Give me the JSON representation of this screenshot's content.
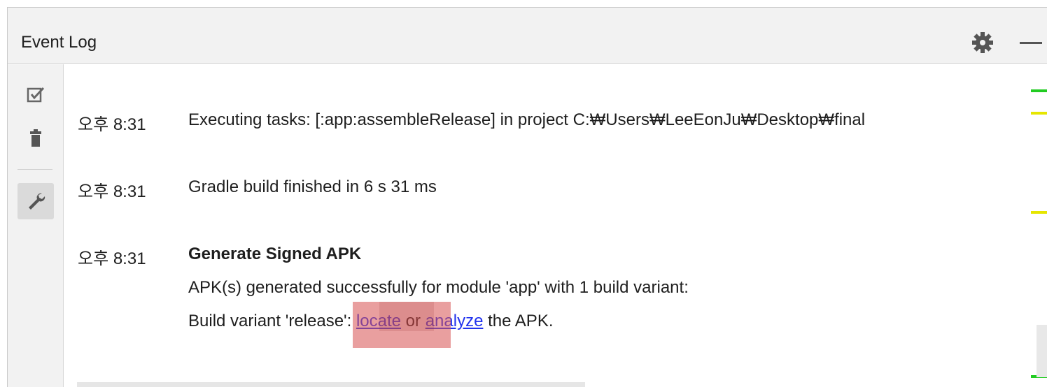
{
  "panel": {
    "title": "Event Log"
  },
  "icons": {
    "settings": "gear-icon",
    "minimize": "minimize-icon",
    "mark_all_read": "checkbox-check-icon",
    "clear_all": "trash-icon",
    "settings_tool": "wrench-icon"
  },
  "events": [
    {
      "time": "오후 8:31",
      "text": "Executing tasks: [:app:assembleRelease] in project C:₩Users₩LeeEonJu₩Desktop₩final"
    },
    {
      "time": "오후 8:31",
      "text": "Gradle build finished in 6 s 31 ms"
    },
    {
      "time": "오후 8:31",
      "title": "Generate Signed APK",
      "line1": "APK(s) generated successfully for module 'app' with 1 build variant:",
      "line2_prefix": "Build variant 'release': ",
      "link_locate": "locate",
      "mid": " or ",
      "link_analyze": "analyze",
      "suffix": " the APK."
    }
  ],
  "colors": {
    "link": "#2233ee",
    "marker_green": "#22cc22",
    "marker_yellow": "#e6e600",
    "highlight": "#d75050"
  }
}
